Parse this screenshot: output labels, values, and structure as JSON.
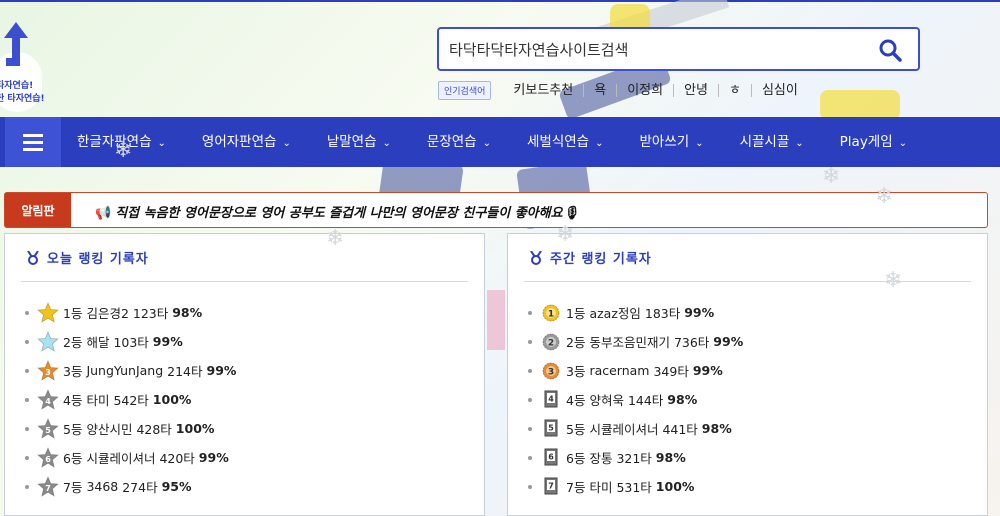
{
  "logo": {
    "text_line1": "타자연습!",
    "text_line2": "탄 타자연습!"
  },
  "search": {
    "value": "타닥타닥타자연습사이트검색"
  },
  "keywords": {
    "tag": "인기검색어",
    "items": [
      "키보드추천",
      "욕",
      "이정희",
      "안녕",
      "ㅎ",
      "심심이"
    ]
  },
  "nav": {
    "items": [
      {
        "label": "한글자판연습"
      },
      {
        "label": "영어자판연습"
      },
      {
        "label": "낱말연습"
      },
      {
        "label": "문장연습"
      },
      {
        "label": "세벌식연습"
      },
      {
        "label": "받아쓰기"
      },
      {
        "label": "시끌시끌"
      },
      {
        "label": "Play게임"
      }
    ]
  },
  "notice": {
    "label": "알림판",
    "text": "직접 녹음한 영어문장으로 영어 공부도 즐겁게 나만의 영어문장 친구들이 좋아해요"
  },
  "today_ranking": {
    "title": "오늘 랭킹 기록자",
    "rows": [
      {
        "rank": "1등",
        "name": "김은경2",
        "strokes": "123타",
        "accuracy": "98%",
        "icon": "star-gold-icon",
        "color": "#f2c21b",
        "num": ""
      },
      {
        "rank": "2등",
        "name": "해달",
        "strokes": "103타",
        "accuracy": "99%",
        "icon": "star-light-icon",
        "color": "#a8e1f2",
        "num": ""
      },
      {
        "rank": "3등",
        "name": "JungYunJang",
        "strokes": "214타",
        "accuracy": "99%",
        "icon": "star-bronze-icon",
        "color": "#e98a2b",
        "num": "3"
      },
      {
        "rank": "4등",
        "name": "타미",
        "strokes": "542타",
        "accuracy": "100%",
        "icon": "star-gray-icon",
        "color": "#8a8a8a",
        "num": "4"
      },
      {
        "rank": "5등",
        "name": "양산시민",
        "strokes": "428타",
        "accuracy": "100%",
        "icon": "star-gray-icon",
        "color": "#8a8a8a",
        "num": "5"
      },
      {
        "rank": "6등",
        "name": "시큘레이셔너",
        "strokes": "420타",
        "accuracy": "99%",
        "icon": "star-gray-icon",
        "color": "#8a8a8a",
        "num": "6"
      },
      {
        "rank": "7등",
        "name": "3468",
        "strokes": "274타",
        "accuracy": "95%",
        "icon": "star-gray-icon",
        "color": "#8a8a8a",
        "num": "7"
      }
    ]
  },
  "weekly_ranking": {
    "title": "주간 랭킹 기록자",
    "rows": [
      {
        "rank": "1등",
        "name": "azaz정임",
        "strokes": "183타",
        "accuracy": "99%",
        "icon": "medal-gold-icon",
        "color": "#f2c21b",
        "num": "1"
      },
      {
        "rank": "2등",
        "name": "동부조음민재기",
        "strokes": "736타",
        "accuracy": "99%",
        "icon": "medal-silver-icon",
        "color": "#9a9a9a",
        "num": "2"
      },
      {
        "rank": "3등",
        "name": "racernam",
        "strokes": "349타",
        "accuracy": "99%",
        "icon": "medal-bronze-icon",
        "color": "#e98a2b",
        "num": "3"
      },
      {
        "rank": "4등",
        "name": "양혀욱",
        "strokes": "144타",
        "accuracy": "98%",
        "icon": "flag-icon",
        "color": "#777777",
        "num": "4"
      },
      {
        "rank": "5등",
        "name": "시큘레이셔너",
        "strokes": "441타",
        "accuracy": "98%",
        "icon": "flag-icon",
        "color": "#777777",
        "num": "5"
      },
      {
        "rank": "6등",
        "name": "장통",
        "strokes": "321타",
        "accuracy": "98%",
        "icon": "flag-icon",
        "color": "#777777",
        "num": "6"
      },
      {
        "rank": "7등",
        "name": "타미",
        "strokes": "531타",
        "accuracy": "100%",
        "icon": "flag-icon",
        "color": "#777777",
        "num": "7"
      }
    ]
  },
  "colors": {
    "nav": "#2b3fbe",
    "notice_label": "#c73a1d",
    "accent": "#3b4fcf"
  }
}
